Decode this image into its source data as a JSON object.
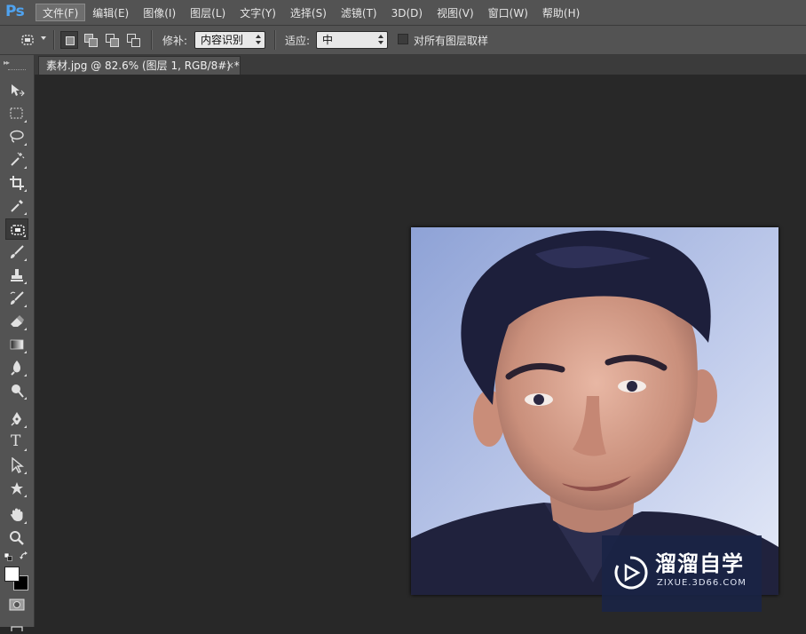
{
  "app": {
    "logo": "Ps"
  },
  "menu": {
    "items": [
      "文件(F)",
      "编辑(E)",
      "图像(I)",
      "图层(L)",
      "文字(Y)",
      "选择(S)",
      "滤镜(T)",
      "3D(D)",
      "视图(V)",
      "窗口(W)",
      "帮助(H)"
    ],
    "active_index": 0
  },
  "options": {
    "tool_icon": "patch-tool-icon",
    "patch_label": "修补:",
    "patch_value": "内容识别",
    "adapt_label": "适应:",
    "adapt_value": "中",
    "sample_all_label": "对所有图层取样",
    "sample_all_checked": false
  },
  "document": {
    "tab_title": "素材.jpg @ 82.6% (图层 1, RGB/8#) *",
    "close_glyph": "×"
  },
  "toolbar": {
    "tools": [
      "move-tool-icon",
      "marquee-tool-icon",
      "lasso-tool-icon",
      "magic-wand-tool-icon",
      "crop-tool-icon",
      "eyedropper-tool-icon",
      "patch-tool-icon",
      "brush-tool-icon",
      "clone-stamp-tool-icon",
      "history-brush-tool-icon",
      "eraser-tool-icon",
      "gradient-tool-icon",
      "blur-tool-icon",
      "dodge-tool-icon",
      "pen-tool-icon",
      "type-tool-icon",
      "path-selection-tool-icon",
      "custom-shape-tool-icon",
      "hand-tool-icon",
      "zoom-tool-icon"
    ],
    "active_tool": "patch-tool-icon",
    "type_glyph": "T",
    "foreground_color": "#ffffff",
    "background_color": "#000000"
  },
  "watermark": {
    "title": "溜溜自学",
    "url": "ZIXUE.3D66.COM"
  }
}
